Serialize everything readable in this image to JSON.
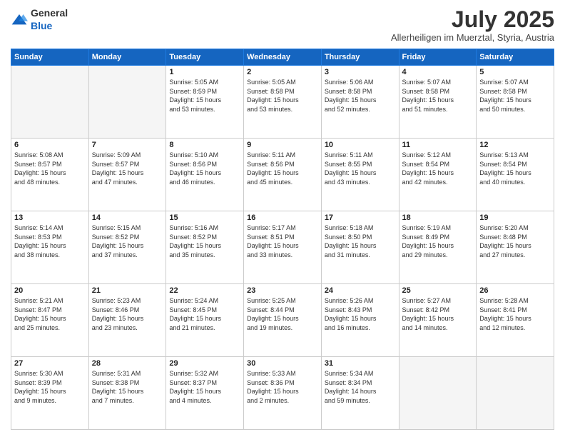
{
  "header": {
    "logo_general": "General",
    "logo_blue": "Blue",
    "month": "July 2025",
    "location": "Allerheiligen im Muerztal, Styria, Austria"
  },
  "days_of_week": [
    "Sunday",
    "Monday",
    "Tuesday",
    "Wednesday",
    "Thursday",
    "Friday",
    "Saturday"
  ],
  "weeks": [
    [
      {
        "day": "",
        "info": ""
      },
      {
        "day": "",
        "info": ""
      },
      {
        "day": "1",
        "info": "Sunrise: 5:05 AM\nSunset: 8:59 PM\nDaylight: 15 hours\nand 53 minutes."
      },
      {
        "day": "2",
        "info": "Sunrise: 5:05 AM\nSunset: 8:58 PM\nDaylight: 15 hours\nand 53 minutes."
      },
      {
        "day": "3",
        "info": "Sunrise: 5:06 AM\nSunset: 8:58 PM\nDaylight: 15 hours\nand 52 minutes."
      },
      {
        "day": "4",
        "info": "Sunrise: 5:07 AM\nSunset: 8:58 PM\nDaylight: 15 hours\nand 51 minutes."
      },
      {
        "day": "5",
        "info": "Sunrise: 5:07 AM\nSunset: 8:58 PM\nDaylight: 15 hours\nand 50 minutes."
      }
    ],
    [
      {
        "day": "6",
        "info": "Sunrise: 5:08 AM\nSunset: 8:57 PM\nDaylight: 15 hours\nand 48 minutes."
      },
      {
        "day": "7",
        "info": "Sunrise: 5:09 AM\nSunset: 8:57 PM\nDaylight: 15 hours\nand 47 minutes."
      },
      {
        "day": "8",
        "info": "Sunrise: 5:10 AM\nSunset: 8:56 PM\nDaylight: 15 hours\nand 46 minutes."
      },
      {
        "day": "9",
        "info": "Sunrise: 5:11 AM\nSunset: 8:56 PM\nDaylight: 15 hours\nand 45 minutes."
      },
      {
        "day": "10",
        "info": "Sunrise: 5:11 AM\nSunset: 8:55 PM\nDaylight: 15 hours\nand 43 minutes."
      },
      {
        "day": "11",
        "info": "Sunrise: 5:12 AM\nSunset: 8:54 PM\nDaylight: 15 hours\nand 42 minutes."
      },
      {
        "day": "12",
        "info": "Sunrise: 5:13 AM\nSunset: 8:54 PM\nDaylight: 15 hours\nand 40 minutes."
      }
    ],
    [
      {
        "day": "13",
        "info": "Sunrise: 5:14 AM\nSunset: 8:53 PM\nDaylight: 15 hours\nand 38 minutes."
      },
      {
        "day": "14",
        "info": "Sunrise: 5:15 AM\nSunset: 8:52 PM\nDaylight: 15 hours\nand 37 minutes."
      },
      {
        "day": "15",
        "info": "Sunrise: 5:16 AM\nSunset: 8:52 PM\nDaylight: 15 hours\nand 35 minutes."
      },
      {
        "day": "16",
        "info": "Sunrise: 5:17 AM\nSunset: 8:51 PM\nDaylight: 15 hours\nand 33 minutes."
      },
      {
        "day": "17",
        "info": "Sunrise: 5:18 AM\nSunset: 8:50 PM\nDaylight: 15 hours\nand 31 minutes."
      },
      {
        "day": "18",
        "info": "Sunrise: 5:19 AM\nSunset: 8:49 PM\nDaylight: 15 hours\nand 29 minutes."
      },
      {
        "day": "19",
        "info": "Sunrise: 5:20 AM\nSunset: 8:48 PM\nDaylight: 15 hours\nand 27 minutes."
      }
    ],
    [
      {
        "day": "20",
        "info": "Sunrise: 5:21 AM\nSunset: 8:47 PM\nDaylight: 15 hours\nand 25 minutes."
      },
      {
        "day": "21",
        "info": "Sunrise: 5:23 AM\nSunset: 8:46 PM\nDaylight: 15 hours\nand 23 minutes."
      },
      {
        "day": "22",
        "info": "Sunrise: 5:24 AM\nSunset: 8:45 PM\nDaylight: 15 hours\nand 21 minutes."
      },
      {
        "day": "23",
        "info": "Sunrise: 5:25 AM\nSunset: 8:44 PM\nDaylight: 15 hours\nand 19 minutes."
      },
      {
        "day": "24",
        "info": "Sunrise: 5:26 AM\nSunset: 8:43 PM\nDaylight: 15 hours\nand 16 minutes."
      },
      {
        "day": "25",
        "info": "Sunrise: 5:27 AM\nSunset: 8:42 PM\nDaylight: 15 hours\nand 14 minutes."
      },
      {
        "day": "26",
        "info": "Sunrise: 5:28 AM\nSunset: 8:41 PM\nDaylight: 15 hours\nand 12 minutes."
      }
    ],
    [
      {
        "day": "27",
        "info": "Sunrise: 5:30 AM\nSunset: 8:39 PM\nDaylight: 15 hours\nand 9 minutes."
      },
      {
        "day": "28",
        "info": "Sunrise: 5:31 AM\nSunset: 8:38 PM\nDaylight: 15 hours\nand 7 minutes."
      },
      {
        "day": "29",
        "info": "Sunrise: 5:32 AM\nSunset: 8:37 PM\nDaylight: 15 hours\nand 4 minutes."
      },
      {
        "day": "30",
        "info": "Sunrise: 5:33 AM\nSunset: 8:36 PM\nDaylight: 15 hours\nand 2 minutes."
      },
      {
        "day": "31",
        "info": "Sunrise: 5:34 AM\nSunset: 8:34 PM\nDaylight: 14 hours\nand 59 minutes."
      },
      {
        "day": "",
        "info": ""
      },
      {
        "day": "",
        "info": ""
      }
    ]
  ]
}
